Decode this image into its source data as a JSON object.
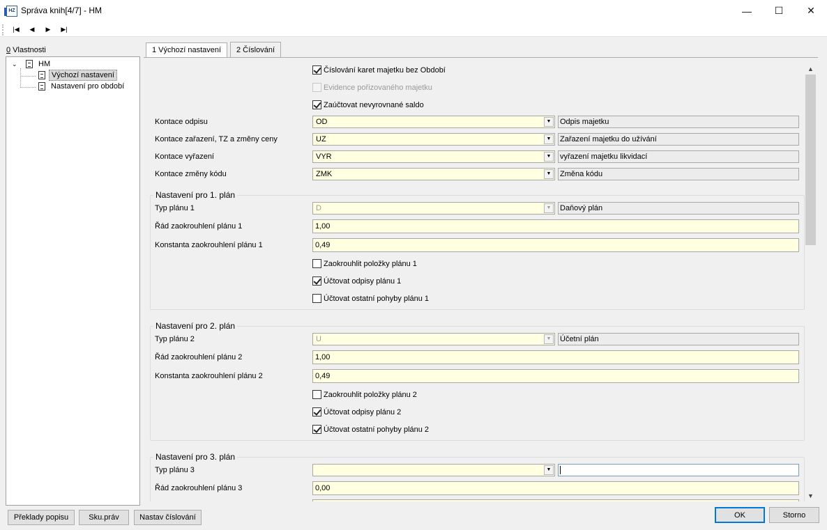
{
  "window": {
    "title": "Správa knih[4/7] - HM",
    "app_icon_text": "HZ",
    "minimize": "—",
    "maximize": "☐",
    "close": "✕"
  },
  "toolbar": {
    "first": "|◀",
    "prev": "◀",
    "next": "▶",
    "last": "▶|"
  },
  "left_tab": {
    "hotkey": "0",
    "label": " Vlastnosti"
  },
  "tree": {
    "root": "HM",
    "items": [
      "Výchozí nastavení",
      "Nastavení pro období"
    ]
  },
  "tabs": [
    "1 Výchozí nastavení",
    "2 Číslování"
  ],
  "top_checks": [
    {
      "label": "Číslování karet majetku bez Období",
      "checked": true,
      "disabled": false
    },
    {
      "label": "Evidence pořizovaného majetku",
      "checked": false,
      "disabled": true
    },
    {
      "label": "Zaúčtovat nevyrovnané saldo",
      "checked": true,
      "disabled": false
    }
  ],
  "kontace": [
    {
      "label": "Kontace odpisu",
      "code": "OD",
      "desc": "Odpis majetku"
    },
    {
      "label": "Kontace zařazení, TZ a změny ceny",
      "code": "UZ",
      "desc": "Zařazení majetku do užívání"
    },
    {
      "label": "Kontace vyřazení",
      "code": "VYR",
      "desc": "vyřazení majetku likvidací"
    },
    {
      "label": "Kontace změny kódu",
      "code": "ZMK",
      "desc": "Změna kódu"
    }
  ],
  "plans": [
    {
      "title": "Nastavení pro 1. plán",
      "typ_label": "Typ plánu 1",
      "typ_code": "D",
      "typ_desc": "Daňový plán",
      "rad_label": "Řád zaokrouhlení plánu 1",
      "rad_value": "1,00",
      "konst_label": "Konstanta zaokrouhlení plánu 1",
      "konst_value": "0,49",
      "checks": [
        {
          "label": "Zaokrouhlit položky plánu 1",
          "checked": false
        },
        {
          "label": "Účtovat odpisy plánu 1",
          "checked": true
        },
        {
          "label": "Účtovat ostatní pohyby plánu 1",
          "checked": false
        }
      ]
    },
    {
      "title": "Nastavení pro 2. plán",
      "typ_label": "Typ plánu 2",
      "typ_code": "U",
      "typ_desc": "Účetní plán",
      "rad_label": "Řád zaokrouhlení plánu 2",
      "rad_value": "1,00",
      "konst_label": "Konstanta zaokrouhlení plánu 2",
      "konst_value": "0,49",
      "checks": [
        {
          "label": "Zaokrouhlit položky plánu 2",
          "checked": false
        },
        {
          "label": "Účtovat odpisy plánu 2",
          "checked": true
        },
        {
          "label": "Účtovat ostatní pohyby plánu 2",
          "checked": true
        }
      ]
    },
    {
      "title": "Nastavení pro 3. plán",
      "typ_label": "Typ plánu 3",
      "typ_code": "",
      "typ_desc": "",
      "rad_label": "Řád zaokrouhlení plánu 3",
      "rad_value": "0,00"
    }
  ],
  "combo_arrow": "▼",
  "scroll": {
    "up": "▲",
    "down": "▼"
  },
  "bottom_left_buttons": [
    "Překlady popisu",
    "Sku.práv",
    "Nastav číslování"
  ],
  "bottom_right_buttons": {
    "ok": "OK",
    "cancel": "Storno"
  }
}
